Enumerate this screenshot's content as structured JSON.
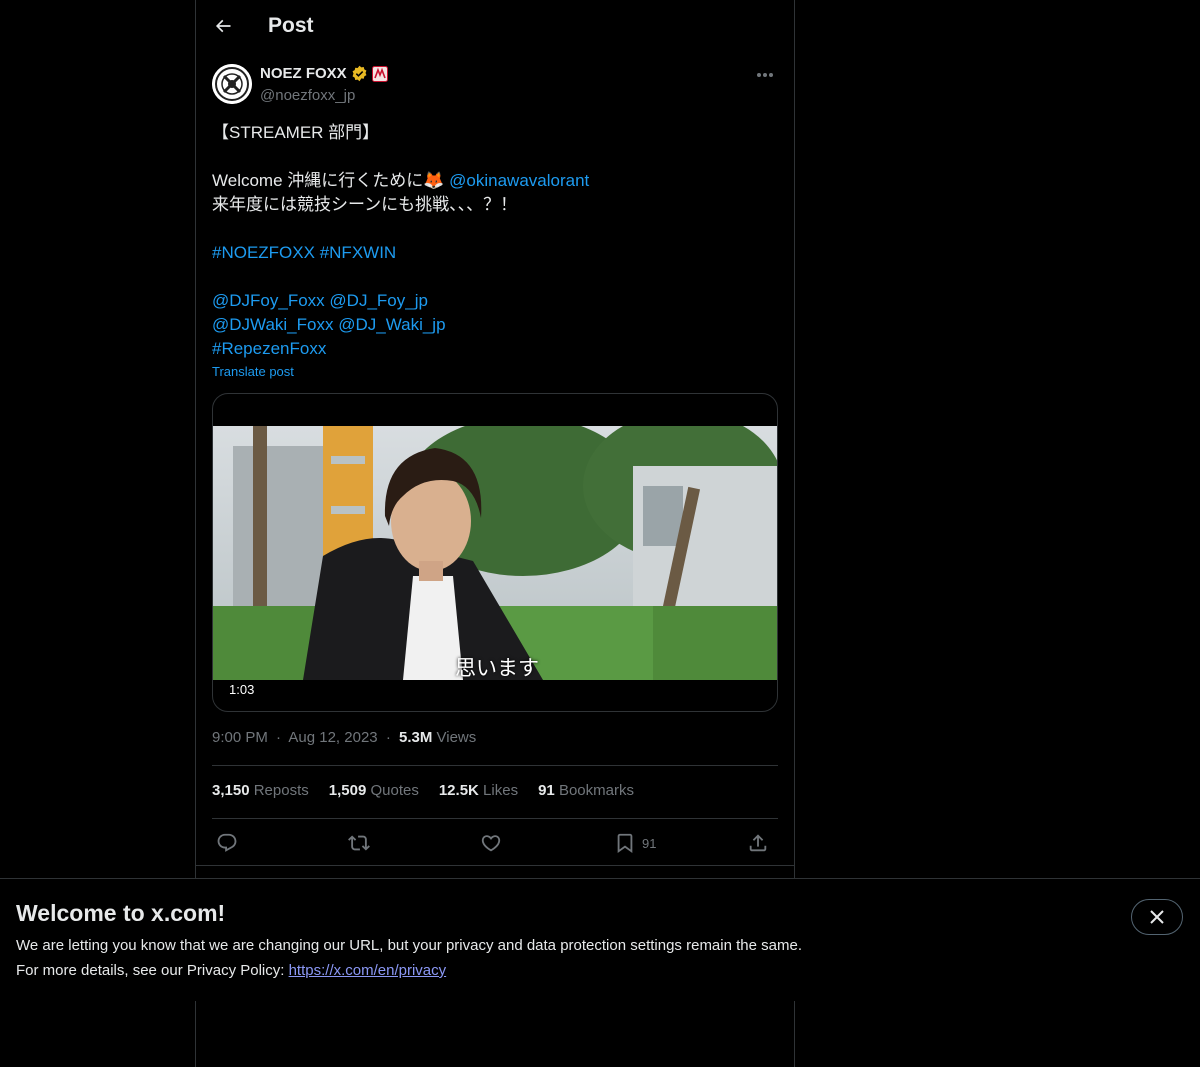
{
  "header": {
    "title": "Post"
  },
  "author": {
    "display_name": "NOEZ FOXX",
    "handle": "@noezfoxx_jp",
    "badge_color": "#e8b923",
    "flag_color": "#c8102e"
  },
  "tweet": {
    "line1": "【STREAMER 部門】",
    "line3_text": "Welcome 沖縄に行くために🦊 ",
    "line3_mention": "@okinawavalorant",
    "line4": "来年度には競技シーンにも挑戦、、、？！",
    "line6_tag1": "#NOEZFOXX",
    "line6_tag2": "#NFXWIN",
    "line8_m1": "@DJFoy_Foxx",
    "line8_m2": "@DJ_Foy_jp",
    "line9_m1": "@DJWaki_Foxx",
    "line9_m2": "@DJ_Waki_jp",
    "line10_tag": "#RepezenFoxx",
    "translate": "Translate post"
  },
  "video": {
    "subtitle": "思います",
    "duration": "1:03"
  },
  "meta": {
    "time": "9:00 PM",
    "date": "Aug 12, 2023",
    "views_count": "5.3M",
    "views_label": "Views",
    "separator": "·"
  },
  "stats": {
    "reposts_count": "3,150",
    "reposts_label": "Reposts",
    "quotes_count": "1,509",
    "quotes_label": "Quotes",
    "likes_count": "12.5K",
    "likes_label": "Likes",
    "bookmarks_count": "91",
    "bookmarks_label": "Bookmarks"
  },
  "actions": {
    "bookmark_count": "91"
  },
  "banner": {
    "title": "Welcome to x.com!",
    "line1": "We are letting you know that we are changing our URL, but your privacy and data protection settings remain the same.",
    "line2_prefix": "For more details, see our Privacy Policy: ",
    "line2_link": "https://x.com/en/privacy"
  },
  "colors": {
    "link": "#1d9bf0",
    "text": "#e7e9ea",
    "muted": "#71767b",
    "border": "#2f3336",
    "background": "#000000"
  }
}
